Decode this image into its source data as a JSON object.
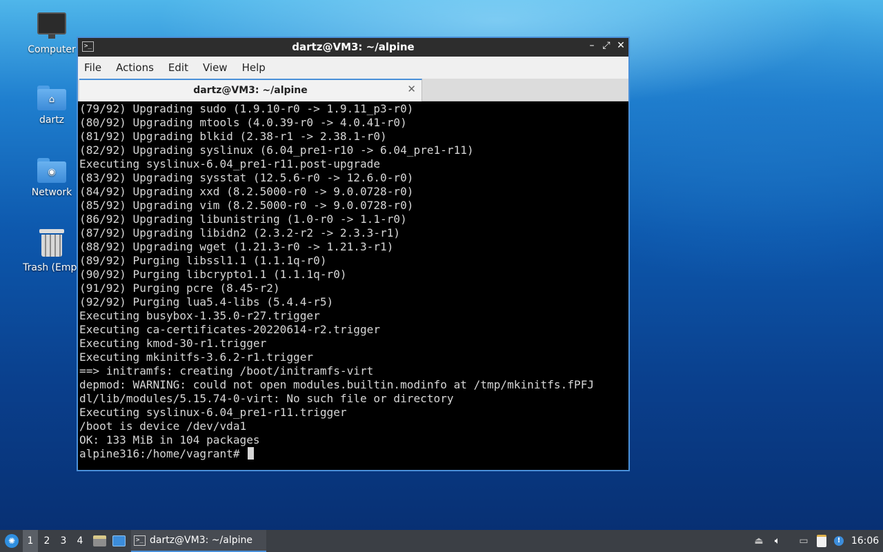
{
  "desktop": {
    "icons": [
      {
        "label": "Computer"
      },
      {
        "label": "dartz"
      },
      {
        "label": "Network"
      },
      {
        "label": "Trash (Empt"
      }
    ]
  },
  "window": {
    "title": "dartz@VM3: ~/alpine",
    "app_icon": ">_",
    "controls": {
      "minimize": "–",
      "maximize": "⤢",
      "close": "✕"
    },
    "menu": [
      "File",
      "Actions",
      "Edit",
      "View",
      "Help"
    ],
    "tab": {
      "label": "dartz@VM3: ~/alpine",
      "close": "✕"
    }
  },
  "terminal": {
    "lines": [
      "(79/92) Upgrading sudo (1.9.10-r0 -> 1.9.11_p3-r0)",
      "(80/92) Upgrading mtools (4.0.39-r0 -> 4.0.41-r0)",
      "(81/92) Upgrading blkid (2.38-r1 -> 2.38.1-r0)",
      "(82/92) Upgrading syslinux (6.04_pre1-r10 -> 6.04_pre1-r11)",
      "Executing syslinux-6.04_pre1-r11.post-upgrade",
      "(83/92) Upgrading sysstat (12.5.6-r0 -> 12.6.0-r0)",
      "(84/92) Upgrading xxd (8.2.5000-r0 -> 9.0.0728-r0)",
      "(85/92) Upgrading vim (8.2.5000-r0 -> 9.0.0728-r0)",
      "(86/92) Upgrading libunistring (1.0-r0 -> 1.1-r0)",
      "(87/92) Upgrading libidn2 (2.3.2-r2 -> 2.3.3-r1)",
      "(88/92) Upgrading wget (1.21.3-r0 -> 1.21.3-r1)",
      "(89/92) Purging libssl1.1 (1.1.1q-r0)",
      "(90/92) Purging libcrypto1.1 (1.1.1q-r0)",
      "(91/92) Purging pcre (8.45-r2)",
      "(92/92) Purging lua5.4-libs (5.4.4-r5)",
      "Executing busybox-1.35.0-r27.trigger",
      "Executing ca-certificates-20220614-r2.trigger",
      "Executing kmod-30-r1.trigger",
      "Executing mkinitfs-3.6.2-r1.trigger",
      "==> initramfs: creating /boot/initramfs-virt",
      "depmod: WARNING: could not open modules.builtin.modinfo at /tmp/mkinitfs.fPFJ",
      "dl/lib/modules/5.15.74-0-virt: No such file or directory",
      "Executing syslinux-6.04_pre1-r11.trigger",
      "/boot is device /dev/vda1",
      "OK: 133 MiB in 104 packages"
    ],
    "prompt": "alpine316:/home/vagrant# "
  },
  "taskbar": {
    "start_icon": "start-menu-icon",
    "workspaces": [
      "1",
      "2",
      "3",
      "4"
    ],
    "active_workspace": "1",
    "task_label": "dartz@VM3: ~/alpine",
    "clock": "16:06"
  },
  "colors": {
    "window_border": "#4a90d9",
    "terminal_bg": "#000000",
    "terminal_fg": "#d6d6d6",
    "taskbar_bg": "#3b3f45"
  }
}
